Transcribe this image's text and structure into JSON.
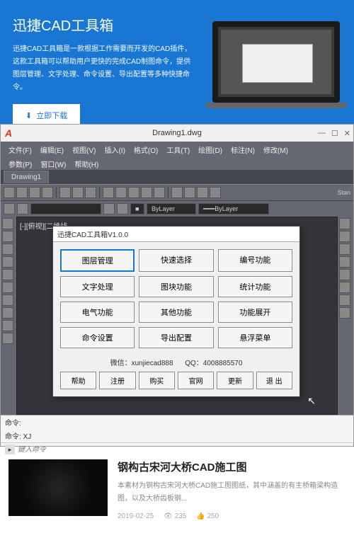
{
  "hero": {
    "title": "迅捷CAD工具箱",
    "desc": "迅捷CAD工具箱是一款根据工作需要而开发的CAD插件，这款工具箱可以帮助用户更快的完成CAD制图命令，提供图层管理、文字处理、命令设置、导出配置等多种快捷命令。",
    "btn": "立即下载"
  },
  "cad": {
    "window_title": "Drawing1.dwg",
    "logo": "A",
    "menu1": [
      "文件(F)",
      "编辑(E)",
      "视图(V)",
      "插入(I)",
      "格式(O)",
      "工具(T)",
      "绘图(D)",
      "标注(N)",
      "修改(M)"
    ],
    "menu2": [
      "参数(P)",
      "窗口(W)",
      "帮助(H)"
    ],
    "tab": "Drawing1",
    "field1": "ByLayer",
    "field2": "ByLayer",
    "side_label": "Stan",
    "canvas_text": "[-][俯视][二维线",
    "cursor_glyph": "↖",
    "toolbox": {
      "title": "迅捷CAD工具箱V1.0.0",
      "buttons": [
        "图层管理",
        "快速选择",
        "编号功能",
        "文字处理",
        "图块功能",
        "统计功能",
        "电气功能",
        "其他功能",
        "功能展开",
        "命令设置",
        "导出配置",
        "悬浮菜单"
      ],
      "wechat_label": "微信：",
      "wechat": "xunjiecad888",
      "qq_label": "QQ：",
      "qq": "4008885570",
      "bottom": [
        "帮助",
        "注册",
        "购买",
        "官网",
        "更新",
        "退 出"
      ]
    },
    "cmd": {
      "line1": "命令:",
      "line2": "命令: XJ",
      "prompt_icon": "▸",
      "input_placeholder": "键入命令"
    }
  },
  "article": {
    "title": "钢构古宋河大桥CAD施工图",
    "desc": "本素材为钢构古宋河大桥CAD施工图图纸，其中涵盖的有主桥箱梁构造图，以及大桥齿板钢...",
    "date": "2019-02-25",
    "views": "235",
    "likes": "250"
  }
}
